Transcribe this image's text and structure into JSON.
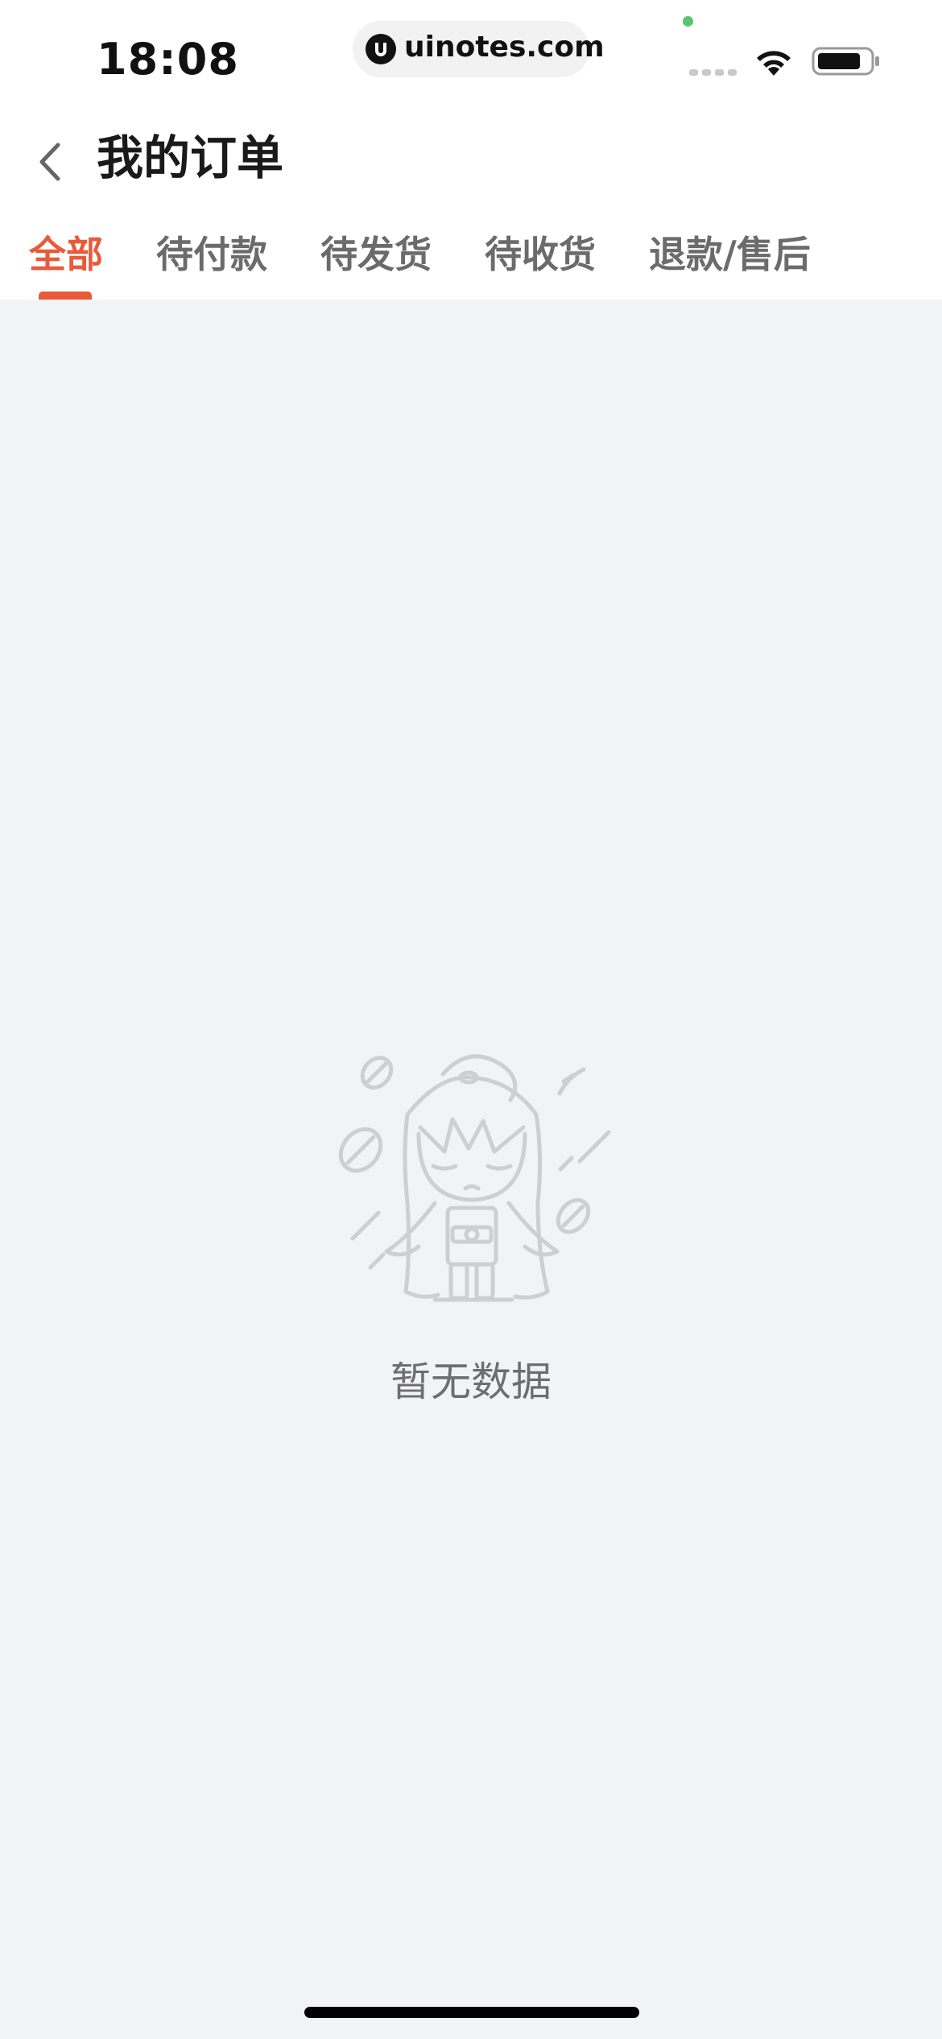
{
  "status_bar": {
    "time": "18:08",
    "url": "uinotes.com"
  },
  "header": {
    "title": "我的订单"
  },
  "tabs": [
    {
      "label": "全部",
      "active": true
    },
    {
      "label": "待付款",
      "active": false
    },
    {
      "label": "待发货",
      "active": false
    },
    {
      "label": "待收货",
      "active": false
    },
    {
      "label": "退款/售后",
      "active": false
    }
  ],
  "empty_state": {
    "message": "暂无数据",
    "icon": "empty-character-illustration"
  },
  "colors": {
    "accent": "#e85a3a",
    "background": "#f2f3f5",
    "text_primary": "#1a1a1a",
    "text_secondary": "#6b6b6b"
  }
}
